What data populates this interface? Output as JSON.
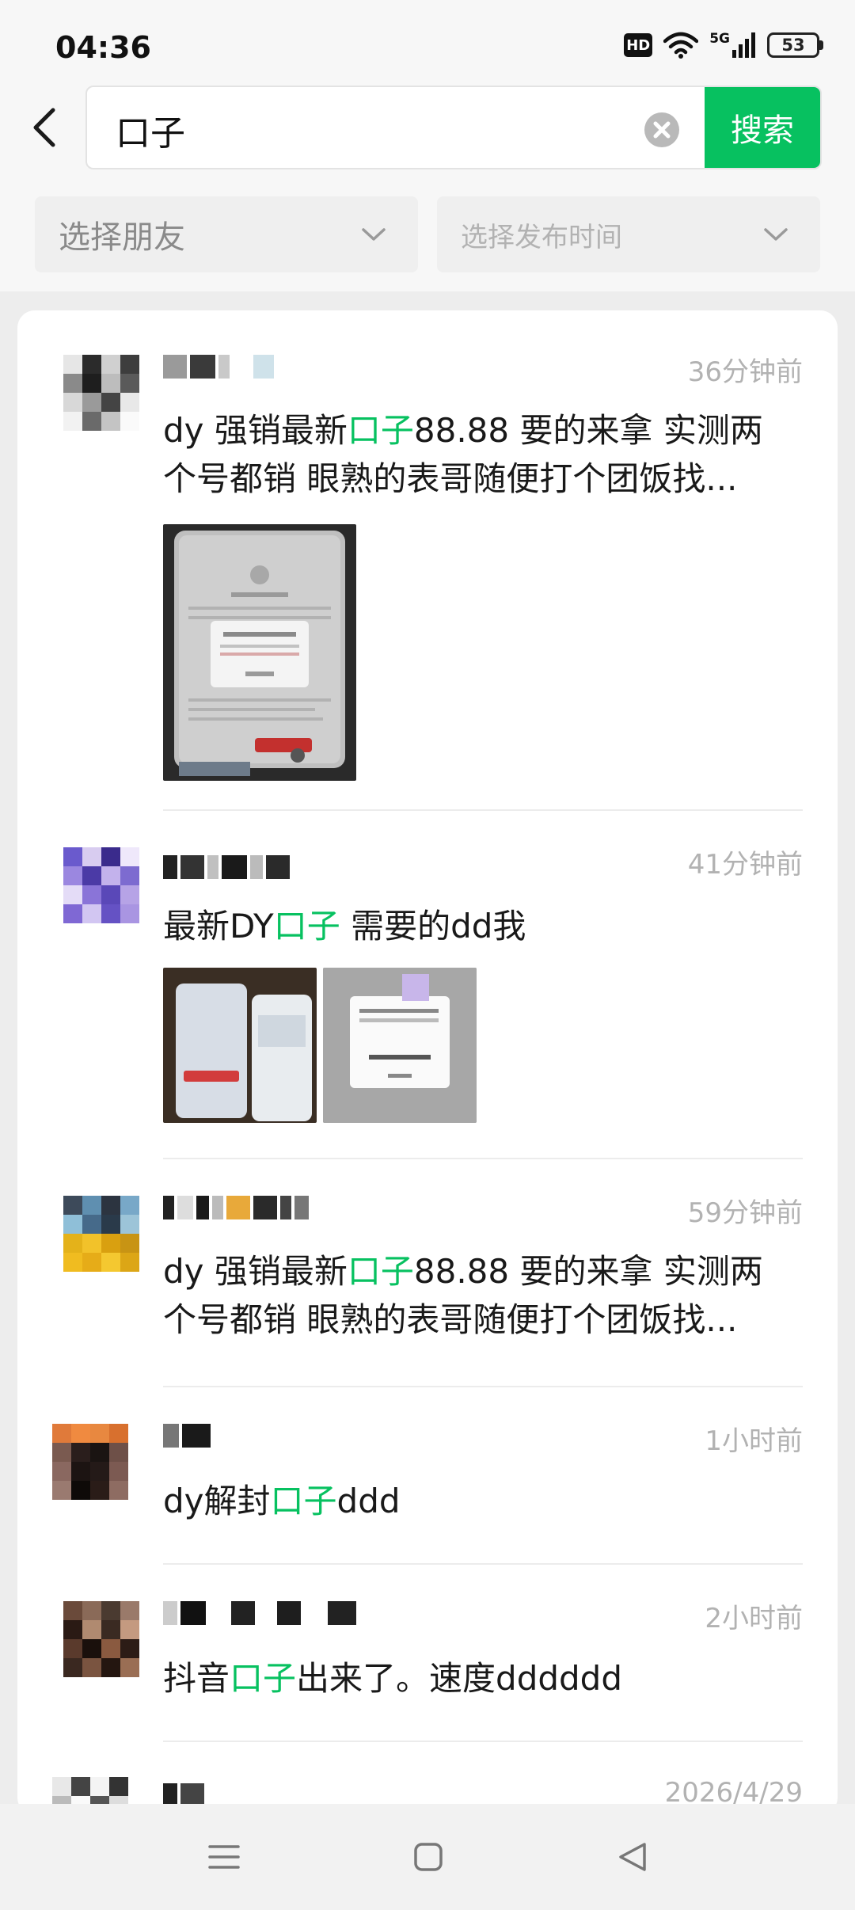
{
  "status_bar": {
    "time": "04:36",
    "hd": "HD",
    "network": "5G",
    "battery": "53"
  },
  "search": {
    "query": "口子",
    "button_label": "搜索"
  },
  "filters": {
    "friends_label": "选择朋友",
    "time_label": "选择发布时间"
  },
  "results": [
    {
      "time": "36分钟前",
      "text_before": "dy 强销最新",
      "highlight": "口子",
      "text_after": "88.88 要的来拿 实测两个号都销 眼熟的表哥随便打个团饭找..."
    },
    {
      "time": "41分钟前",
      "text_before": "最新DY",
      "highlight": "口子",
      "text_after": " 需要的dd我"
    },
    {
      "time": "59分钟前",
      "text_before": "dy 强销最新",
      "highlight": "口子",
      "text_after": "88.88 要的来拿 实测两个号都销 眼熟的表哥随便打个团饭找..."
    },
    {
      "time": "1小时前",
      "text_before": "dy解封",
      "highlight": "口子",
      "text_after": "ddd"
    },
    {
      "time": "2小时前",
      "text_before": "抖音",
      "highlight": "口子",
      "text_after": "出来了。速度dddddd"
    },
    {
      "time": "2026/4/29"
    }
  ],
  "icons": {
    "back": "back-arrow-icon",
    "clear": "clear-circle-icon",
    "chevron": "chevron-down-icon",
    "wifi": "wifi-icon",
    "signal": "signal-icon",
    "nav_menu": "menu-icon",
    "nav_home": "home-square-icon",
    "nav_back": "back-triangle-icon"
  },
  "colors": {
    "accent": "#07c160",
    "time_gray": "#b2b2b2",
    "filter_gray": "#8a8a8a"
  }
}
